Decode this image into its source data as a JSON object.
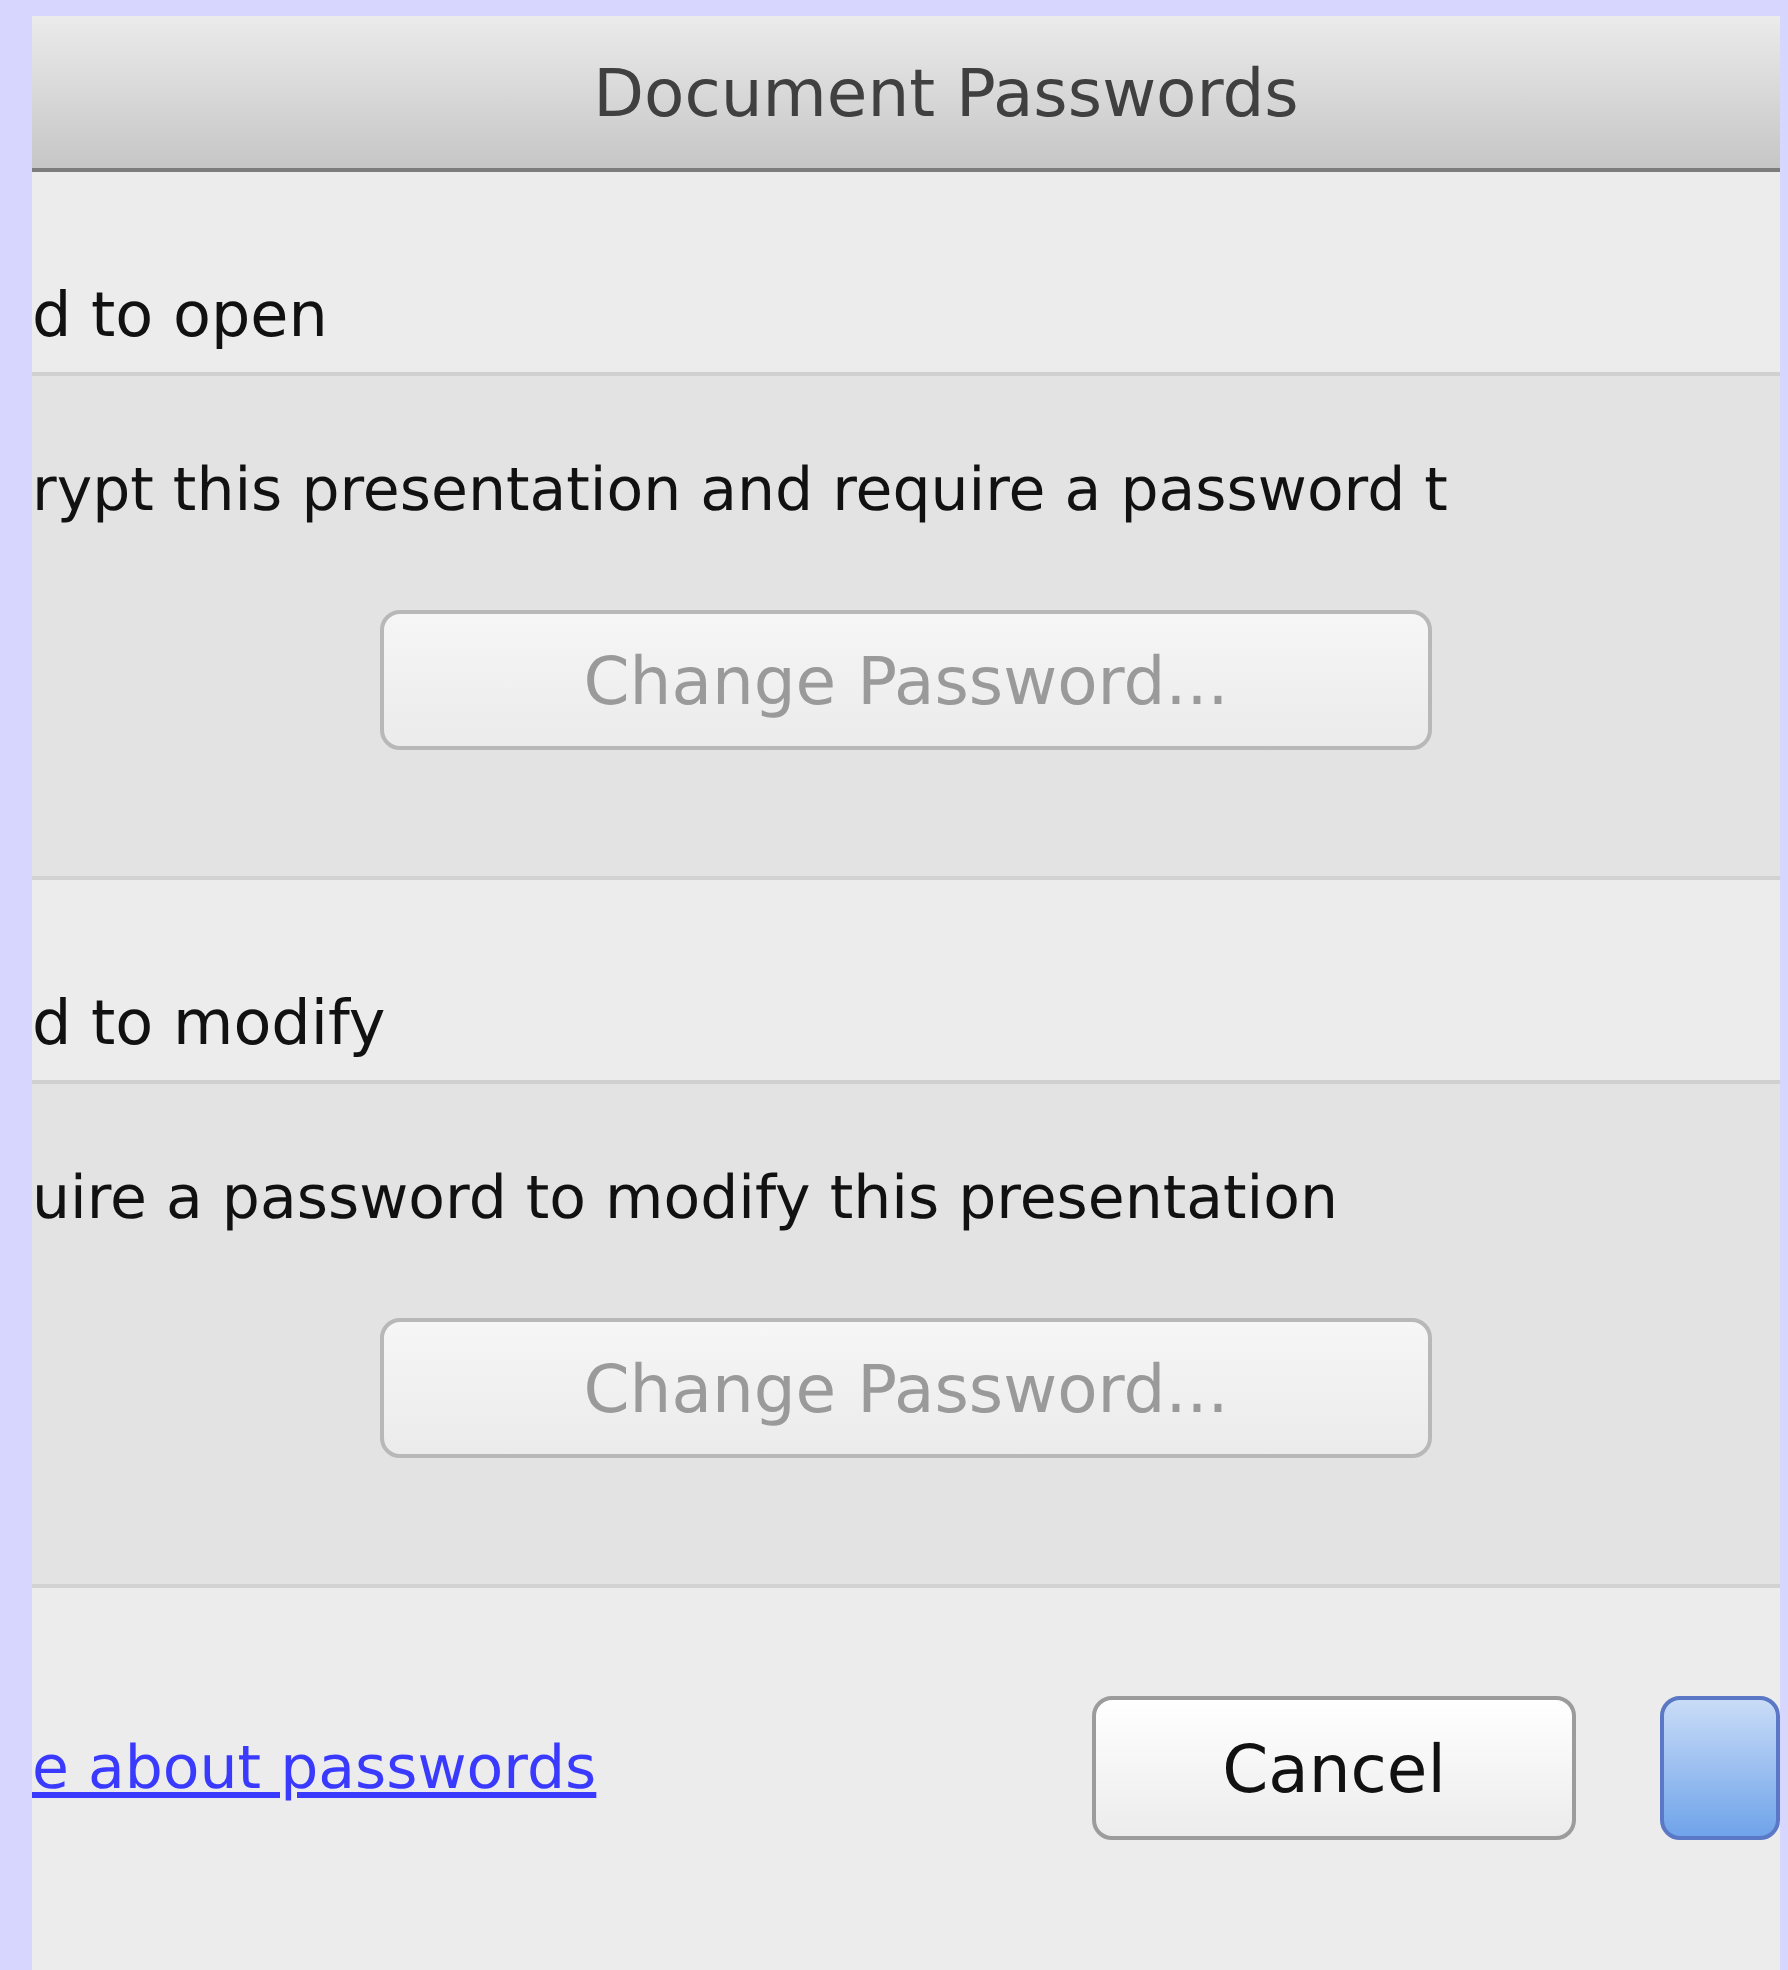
{
  "window": {
    "title": "Document Passwords"
  },
  "sections": [
    {
      "heading": "d to open",
      "description": "rypt this presentation and require a password t",
      "button": {
        "label": "Change Password...",
        "disabled": true
      }
    },
    {
      "heading": "d to modify",
      "description": "uire a password to modify this presentation",
      "button": {
        "label": "Change Password...",
        "disabled": true
      }
    }
  ],
  "footer": {
    "link": "e about passwords",
    "buttons": [
      {
        "kind": "normal",
        "label": "Cancel"
      },
      {
        "kind": "default"
      }
    ]
  }
}
